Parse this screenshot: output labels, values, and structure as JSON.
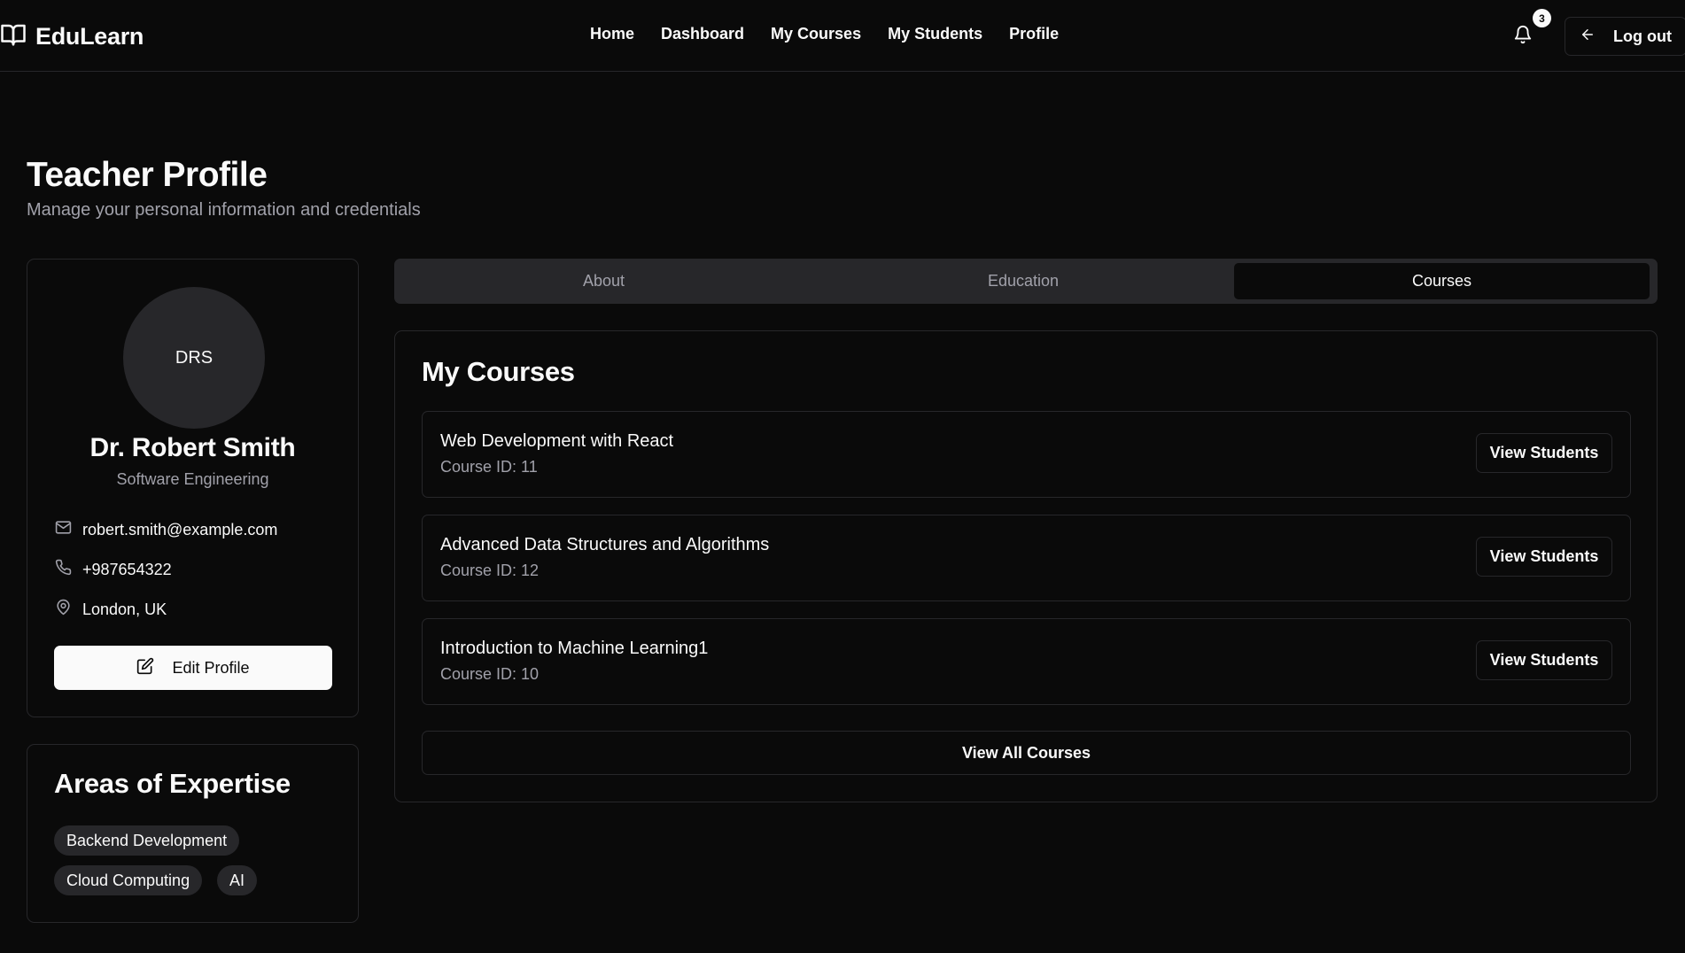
{
  "navbar": {
    "brand": "EduLearn",
    "links": [
      "Home",
      "Dashboard",
      "My Courses",
      "My Students",
      "Profile"
    ],
    "notification_count": "3",
    "logout_label": "Log out"
  },
  "header": {
    "title": "Teacher Profile",
    "subtitle": "Manage your personal information and credentials"
  },
  "profile": {
    "initials": "DRS",
    "name": "Dr. Robert Smith",
    "department": "Software Engineering",
    "email": "robert.smith@example.com",
    "phone": "+987654322",
    "location": "London, UK",
    "edit_label": "Edit Profile"
  },
  "expertise": {
    "title": "Areas of Expertise",
    "tags": [
      "Backend Development",
      "Cloud Computing",
      "AI"
    ]
  },
  "tabs": {
    "items": [
      "About",
      "Education",
      "Courses"
    ],
    "active": "Courses"
  },
  "courses": {
    "title": "My Courses",
    "items": [
      {
        "name": "Web Development with React",
        "id": "Course ID: 11",
        "action": "View Students"
      },
      {
        "name": "Advanced Data Structures and Algorithms",
        "id": "Course ID: 12",
        "action": "View Students"
      },
      {
        "name": "Introduction to Machine Learning1",
        "id": "Course ID: 10",
        "action": "View Students"
      }
    ],
    "view_all_label": "View All Courses"
  },
  "icons": {
    "brand": "book-open-icon",
    "bell": "bell-icon",
    "logout": "arrow-left-icon",
    "email": "mail-icon",
    "phone": "phone-icon",
    "location": "map-pin-icon",
    "edit": "edit-icon"
  }
}
